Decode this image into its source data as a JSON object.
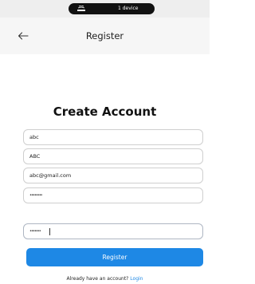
{
  "status_bar": {
    "devices": "1 device"
  },
  "app_bar": {
    "title": "Register",
    "back_icon": "arrow-left-icon"
  },
  "form": {
    "heading": "Create Account",
    "fields": [
      {
        "id": "first-name",
        "value": "abc"
      },
      {
        "id": "last-name",
        "value": "ABC"
      },
      {
        "id": "email",
        "value": "abc@gmail.com"
      },
      {
        "id": "password",
        "value": "••••••••"
      },
      {
        "id": "confirm-password",
        "value": "•••••••"
      }
    ],
    "submit_label": "Register"
  },
  "footer": {
    "prompt": "Already have an account?",
    "login_label": "Login"
  },
  "colors": {
    "accent": "#1e88e5",
    "status_bar_bg": "#eeeeee",
    "app_bar_bg": "#f6f6f6"
  }
}
